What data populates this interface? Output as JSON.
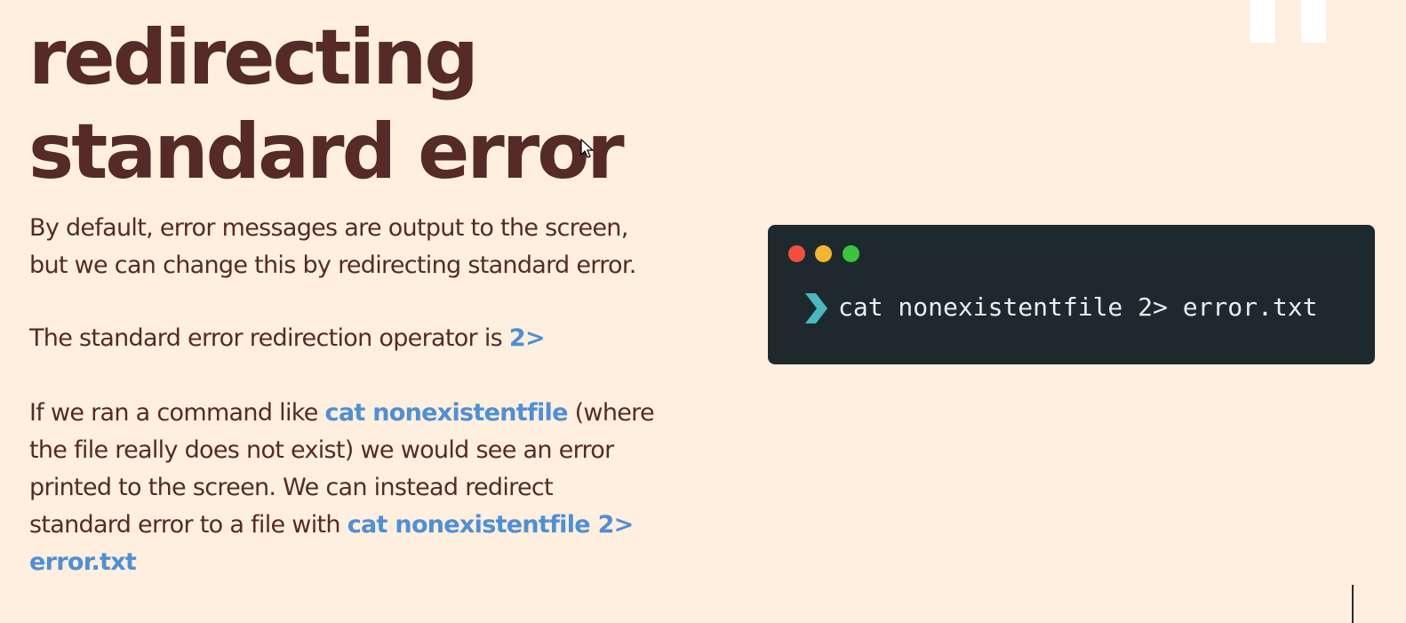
{
  "slide": {
    "title_line1": "redirecting",
    "title_line2": "standard error",
    "paragraph1_line1": "By default, error messages are output to the screen,",
    "paragraph1_line2": "but we can change this by redirecting standard error.",
    "paragraph2_text": "The standard error redirection operator is ",
    "paragraph2_code": "2>",
    "paragraph3_line1_text": "If we ran a command like ",
    "paragraph3_line1_code": "cat nonexistentfile",
    "paragraph3_line1_tail": " (where",
    "paragraph3_line2": "the file really does not exist) we would see an error",
    "paragraph3_line3": "printed to the screen.  We can instead redirect",
    "paragraph3_line4_text": "standard error to a file with ",
    "paragraph3_line4_code": "cat nonexistentfile 2>",
    "paragraph3_line5_code": "error.txt"
  },
  "terminal": {
    "command": "cat nonexistentfile 2> error.txt",
    "prompt_icon": "chevron-right-icon",
    "window_dots": [
      "red",
      "yellow",
      "green"
    ]
  },
  "colors": {
    "background": "#FEEFDF",
    "text": "#552A27",
    "code_highlight": "#4F8FD6",
    "terminal_bg": "#1E292D",
    "prompt": "#4AB8C1",
    "dot_red": "#F24E3F",
    "dot_yellow": "#F6B52E",
    "dot_green": "#3CC43F"
  }
}
